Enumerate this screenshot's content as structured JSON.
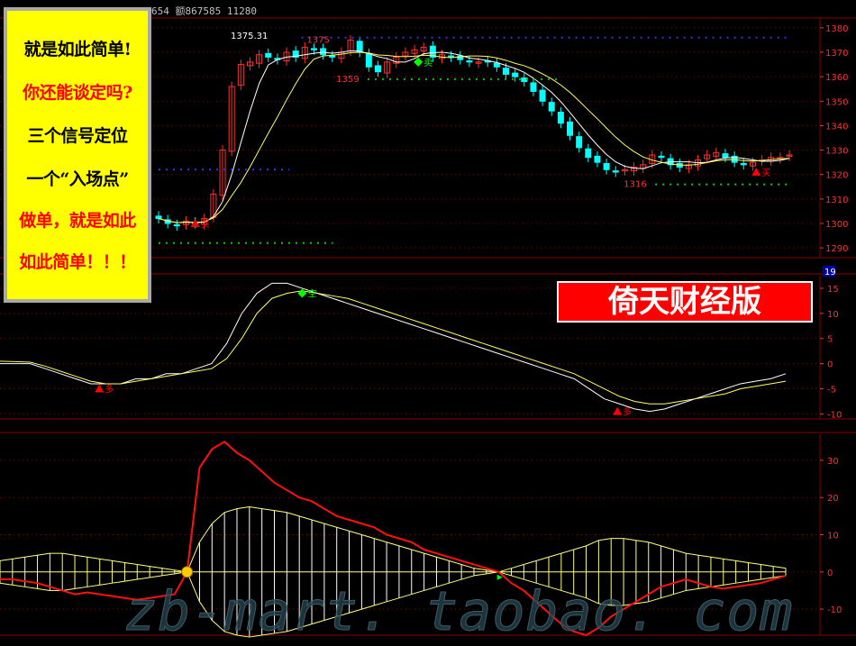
{
  "header": {
    "info_text": "654 额867585 11280"
  },
  "promo": {
    "lines": [
      {
        "text": "就是如此简单!",
        "color": "#000000"
      },
      {
        "text": "你还能谈定吗?",
        "color": "#ff0000"
      },
      {
        "text": "三个信号定位",
        "color": "#000000"
      },
      {
        "text": "一个“入场点”",
        "color": "#000000"
      },
      {
        "text": "做单，就是如此",
        "color": "#ff0000"
      },
      {
        "text": "如此简单！！！",
        "color": "#ff0000"
      }
    ]
  },
  "brand_label": "倚天财经版",
  "watermark": "zb-mart. taobao. com",
  "colors": {
    "grid": "#8b0000",
    "axis_text": "#ff3030",
    "bull": "#ff3030",
    "bear": "#00ffff",
    "ma_fast": "#ffffff",
    "ma_slow": "#ffff66",
    "signal_buy": "#ff0000",
    "signal_sell": "#00ff00",
    "macd_line": "#ff1010",
    "hist": "#ffff80",
    "hist_fill": "#ffffff"
  },
  "chart_data": [
    {
      "type": "candlestick",
      "yticks": [
        1290,
        1300,
        1310,
        1320,
        1330,
        1340,
        1350,
        1360,
        1370,
        1380
      ],
      "ylim": [
        1286,
        1384
      ],
      "high_label": "1375.31",
      "annotations": [
        {
          "text": "1375",
          "x": 85,
          "y": 1375
        },
        {
          "text": "1359",
          "x": 102,
          "y": 1359
        },
        {
          "text": "1316",
          "x": 267,
          "y": 1316
        }
      ],
      "signals": [
        {
          "text": "买",
          "kind": "buy",
          "x": 21,
          "y": 1300
        },
        {
          "text": "卖",
          "kind": "sell",
          "x": 149,
          "y": 1366
        },
        {
          "text": "买",
          "kind": "buy",
          "x": 343,
          "y": 1321
        }
      ],
      "levels": [
        {
          "y": 1376,
          "x0": 82,
          "x1": 362,
          "color": "#3030ff"
        },
        {
          "y": 1322,
          "x0": 0,
          "x1": 75,
          "color": "#3030ff"
        },
        {
          "y": 1292,
          "x0": 0,
          "x1": 100,
          "color": "#00cc00"
        },
        {
          "y": 1359,
          "x0": 120,
          "x1": 230,
          "color": "#00cc00"
        },
        {
          "y": 1316,
          "x0": 285,
          "x1": 362,
          "color": "#00cc00"
        }
      ],
      "closes": [
        1302,
        1300,
        1298,
        1297,
        1299,
        1300,
        1301,
        1302,
        1301,
        1302,
        1303,
        1305,
        1308,
        1313,
        1320,
        1328,
        1336,
        1344,
        1351,
        1357,
        1362,
        1366,
        1368,
        1368,
        1367,
        1367,
        1366,
        1366,
        1367,
        1368,
        1368,
        1369,
        1369,
        1369,
        1368,
        1368,
        1369,
        1370,
        1371,
        1372,
        1373,
        1373,
        1372,
        1372,
        1371,
        1370,
        1369,
        1368,
        1367,
        1366,
        1366,
        1366,
        1365,
        1365,
        1365,
        1364,
        1365,
        1365,
        1366,
        1366,
        1367,
        1367,
        1367,
        1366,
        1366,
        1366,
        1367,
        1367,
        1367,
        1366,
        1366,
        1366,
        1366,
        1367,
        1367,
        1367,
        1366,
        1366,
        1365,
        1365,
        1366,
        1366,
        1366,
        1366,
        1366,
        1365,
        1365,
        1365,
        1364,
        1363,
        1362,
        1361,
        1360,
        1359,
        1358,
        1357,
        1356,
        1355,
        1354,
        1352,
        1350,
        1348,
        1346,
        1344,
        1342,
        1340,
        1338,
        1337,
        1336,
        1334,
        1333,
        1332,
        1331,
        1330,
        1328,
        1327,
        1326,
        1325,
        1324,
        1323,
        1322,
        1322,
        1321,
        1321,
        1321,
        1322,
        1322,
        1322,
        1323,
        1323,
        1324,
        1325,
        1326,
        1327,
        1328,
        1329,
        1329,
        1329,
        1330,
        1330,
        1330,
        1329,
        1328,
        1327,
        1326,
        1325,
        1325,
        1324,
        1324,
        1324,
        1324,
        1325,
        1326,
        1327,
        1328,
        1328,
        1328,
        1328,
        1329,
        1329,
        1329,
        1329,
        1328,
        1328,
        1327,
        1327,
        1327,
        1327,
        1327,
        1327,
        1327,
        1326,
        1326,
        1326,
        1326,
        1327,
        1327,
        1327,
        1327,
        1326,
        1326,
        1326,
        1326,
        1325,
        1325,
        1325,
        1325,
        1325,
        1325,
        1325,
        1325,
        1325,
        1325,
        1325,
        1325,
        1325,
        1325,
        1325,
        1324,
        1324,
        1324,
        1325,
        1325,
        1326,
        1326,
        1326,
        1326,
        1326,
        1326,
        1326,
        1327,
        1327,
        1327,
        1327,
        1327,
        1327,
        1327,
        1327,
        1327,
        1327,
        1327,
        1327,
        1327,
        1327,
        1327,
        1327,
        1327,
        1327,
        1327,
        1327,
        1327,
        1327,
        1327,
        1327,
        1327,
        1327,
        1327,
        1327,
        1327,
        1327,
        1327,
        1327,
        1327,
        1327,
        1327,
        1327,
        1327,
        1327,
        1327,
        1327,
        1327,
        1327,
        1327,
        1327,
        1327,
        1327,
        1327,
        1327,
        1327,
        1327,
        1327,
        1327,
        1327,
        1327,
        1327,
        1327,
        1327,
        1327,
        1327,
        1327,
        1327,
        1327,
        1327,
        1327,
        1327,
        1327,
        1327,
        1327,
        1327,
        1327,
        1327,
        1327,
        1327,
        1327,
        1327,
        1327,
        1327,
        1327,
        1327,
        1327,
        1327,
        1327,
        1327,
        1327,
        1327,
        1327,
        1327,
        1327,
        1327,
        1327,
        1327,
        1327,
        1327,
        1327,
        1327,
        1327,
        1327,
        1327,
        1327,
        1327,
        1327,
        1327,
        1327,
        1327,
        1327,
        1327,
        1327,
        1327,
        1327,
        1327,
        1327,
        1327,
        1327,
        1327,
        1327,
        1327,
        1327
      ]
    },
    {
      "type": "line",
      "yticks": [
        15,
        10,
        5,
        0,
        -5,
        -10
      ],
      "ylim": [
        -11,
        17.5
      ],
      "badge": "19",
      "signals": [
        {
          "text": "多",
          "kind": "buy",
          "x": 23,
          "y": -5
        },
        {
          "text": "空",
          "kind": "sell",
          "x": 70,
          "y": 14
        },
        {
          "text": "多",
          "kind": "buy",
          "x": 143,
          "y": -9.5
        }
      ]
    },
    {
      "type": "histogram",
      "yticks": [
        30,
        20,
        10,
        0,
        -10
      ],
      "ylim": [
        -17,
        37
      ]
    }
  ]
}
